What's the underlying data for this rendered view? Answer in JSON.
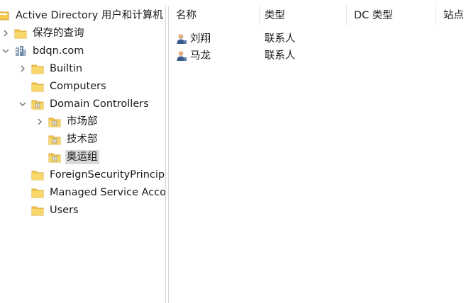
{
  "tree": {
    "root_label": "Active Directory 用户和计算机",
    "items": [
      {
        "label": "保存的查询",
        "icon": "folder-icon"
      },
      {
        "label": "bdqn.com",
        "icon": "domain-icon"
      },
      {
        "label": "Builtin",
        "icon": "folder-icon"
      },
      {
        "label": "Computers",
        "icon": "folder-icon"
      },
      {
        "label": "Domain Controllers",
        "icon": "ou-icon"
      },
      {
        "label": "市场部",
        "icon": "ou-icon"
      },
      {
        "label": "技术部",
        "icon": "ou-icon"
      },
      {
        "label": "奥运组",
        "icon": "ou-icon",
        "selected": true
      },
      {
        "label": "ForeignSecurityPrincipals",
        "icon": "folder-icon"
      },
      {
        "label": "Managed Service Accounts",
        "icon": "folder-icon"
      },
      {
        "label": "Users",
        "icon": "folder-icon"
      }
    ]
  },
  "list": {
    "columns": [
      "名称",
      "类型",
      "DC 类型",
      "站点"
    ],
    "rows": [
      {
        "name": "刘翔",
        "type": "联系人",
        "icon": "contact-icon"
      },
      {
        "name": "马龙",
        "type": "联系人",
        "icon": "contact-icon"
      }
    ]
  },
  "colors": {
    "folder": "#f3c94e",
    "selection": "#d9d9d9"
  }
}
